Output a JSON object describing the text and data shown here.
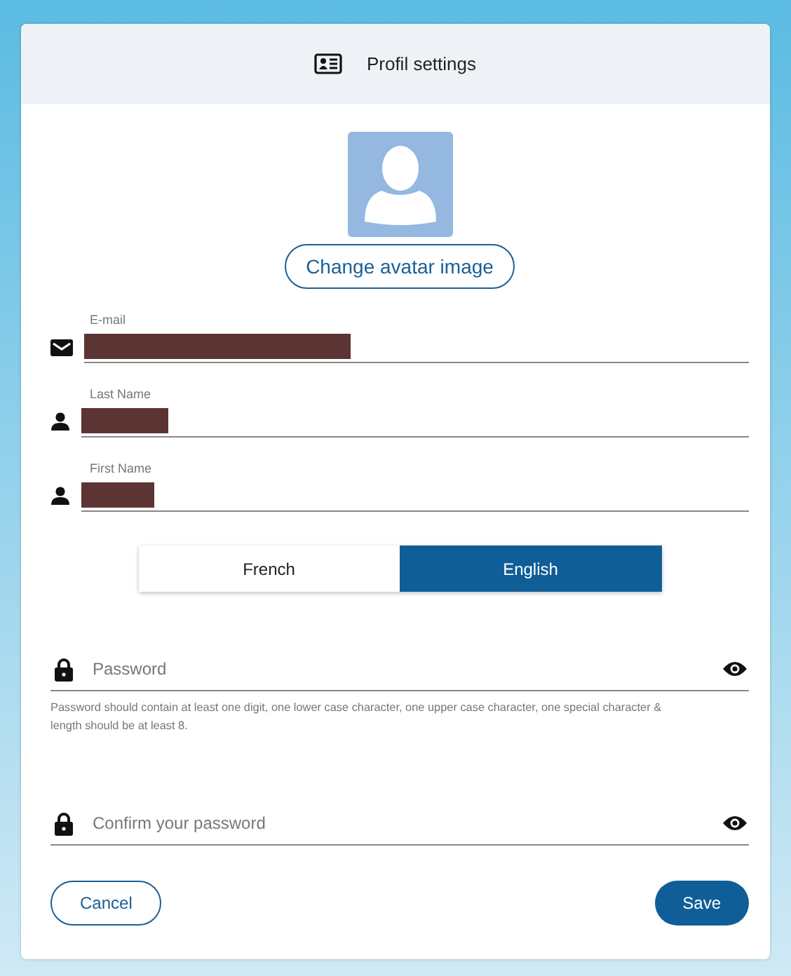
{
  "header": {
    "title": "Profil settings"
  },
  "avatar": {
    "button": "Change avatar image"
  },
  "fields": [
    {
      "kind": "email",
      "label": "E-mail",
      "redacted": true
    },
    {
      "kind": "person",
      "label": "Last Name",
      "redacted": true
    },
    {
      "kind": "person",
      "label": "First Name",
      "redacted": true
    }
  ],
  "languages": [
    {
      "label": "French",
      "selected": false
    },
    {
      "label": "English",
      "selected": true
    }
  ],
  "passwords": [
    {
      "placeholder": "Password",
      "hint": "Password should contain at least one digit, one lower case character, one upper case character, one special character & length should be at least 8."
    },
    {
      "placeholder": "Confirm your password"
    }
  ],
  "buttons": [
    {
      "kind": "secondary",
      "label": "Cancel"
    },
    {
      "kind": "primary",
      "label": "Save"
    }
  ]
}
